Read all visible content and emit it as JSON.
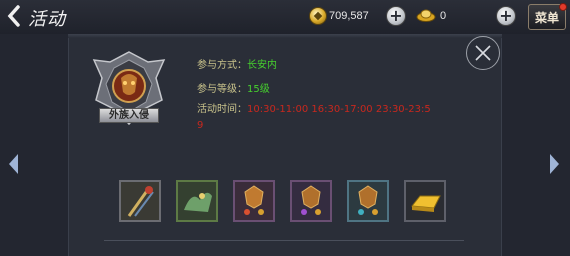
{
  "header": {
    "title": "活动",
    "back_icon": "back-chevron-icon",
    "coins": "709,587",
    "ingots": "0",
    "menu_label": "菜单"
  },
  "activity": {
    "emblem_text": "外族入侵",
    "method_label": "参与方式：",
    "method_value": "长安内",
    "level_label": "参与等级：",
    "level_value": "15级",
    "time_label": "活动时间：",
    "time_value": "10:30-11:00 16:30-17:00 23:30-23:5",
    "time_value_wrap": "9"
  },
  "rewards": [
    {
      "name": "weapon-item-icon"
    },
    {
      "name": "dragon-mount-item-icon"
    },
    {
      "name": "emblem-fragment-red-icon"
    },
    {
      "name": "emblem-fragment-purple-icon"
    },
    {
      "name": "emblem-fragment-teal-icon"
    },
    {
      "name": "gold-ingot-item-icon"
    }
  ],
  "colors": {
    "label": "#c9c38b",
    "value_green": "#46d12e",
    "value_red": "#c8281e",
    "panel_bg": "#2a2e38"
  }
}
